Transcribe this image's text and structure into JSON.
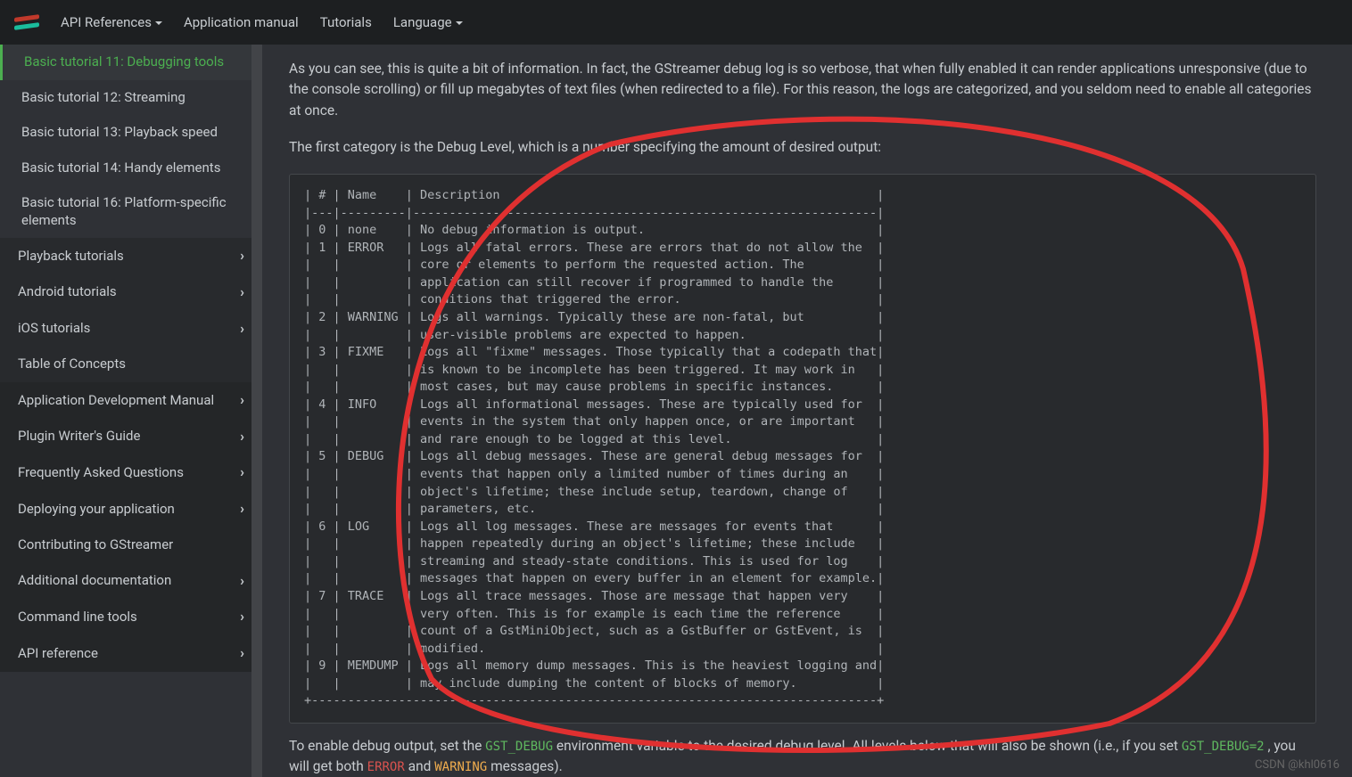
{
  "nav": {
    "api": "API References",
    "manual": "Application manual",
    "tutorials": "Tutorials",
    "language": "Language"
  },
  "sidebar": {
    "items": [
      {
        "label": "Basic tutorial 11: Debugging tools",
        "cls": "sb-item sub active"
      },
      {
        "label": "Basic tutorial 12: Streaming",
        "cls": "sb-item sub"
      },
      {
        "label": "Basic tutorial 13: Playback speed",
        "cls": "sb-item sub"
      },
      {
        "label": "Basic tutorial 14: Handy elements",
        "cls": "sb-item sub"
      },
      {
        "label": "Basic tutorial 16: Platform-specific elements",
        "cls": "sb-item sub"
      },
      {
        "label": "Playback tutorials",
        "cls": "sb-item dark",
        "chev": true
      },
      {
        "label": "Android tutorials",
        "cls": "sb-item dark",
        "chev": true
      },
      {
        "label": "iOS tutorials",
        "cls": "sb-item dark",
        "chev": true
      },
      {
        "label": "Table of Concepts",
        "cls": "sb-item dark"
      },
      {
        "label": "Application Development Manual",
        "cls": "sb-item dark2",
        "chev": true
      },
      {
        "label": "Plugin Writer's Guide",
        "cls": "sb-item dark2",
        "chev": true
      },
      {
        "label": "Frequently Asked Questions",
        "cls": "sb-item dark2",
        "chev": true
      },
      {
        "label": "Deploying your application",
        "cls": "sb-item dark2",
        "chev": true
      },
      {
        "label": "Contributing to GStreamer",
        "cls": "sb-item dark2"
      },
      {
        "label": "Additional documentation",
        "cls": "sb-item dark2",
        "chev": true
      },
      {
        "label": "Command line tools",
        "cls": "sb-item dark2",
        "chev": true
      },
      {
        "label": "API reference",
        "cls": "sb-item dark2",
        "chev": true
      }
    ]
  },
  "content": {
    "p1": "As you can see, this is quite a bit of information. In fact, the GStreamer debug log is so verbose, that when fully enabled it can render applications unresponsive (due to the console scrolling) or fill up megabytes of text files (when redirected to a file). For this reason, the logs are categorized, and you seldom need to enable all categories at once.",
    "p2": "The first category is the Debug Level, which is a number specifying the amount of desired output:",
    "code": "| # | Name    | Description                                                    |\n|---|---------|----------------------------------------------------------------|\n| 0 | none    | No debug information is output.                                |\n| 1 | ERROR   | Logs all fatal errors. These are errors that do not allow the  |\n|   |         | core or elements to perform the requested action. The          |\n|   |         | application can still recover if programmed to handle the      |\n|   |         | conditions that triggered the error.                           |\n| 2 | WARNING | Logs all warnings. Typically these are non-fatal, but          |\n|   |         | user-visible problems are expected to happen.                  |\n| 3 | FIXME   | Logs all \"fixme\" messages. Those typically that a codepath that|\n|   |         | is known to be incomplete has been triggered. It may work in   |\n|   |         | most cases, but may cause problems in specific instances.      |\n| 4 | INFO    | Logs all informational messages. These are typically used for  |\n|   |         | events in the system that only happen once, or are important   |\n|   |         | and rare enough to be logged at this level.                    |\n| 5 | DEBUG   | Logs all debug messages. These are general debug messages for  |\n|   |         | events that happen only a limited number of times during an    |\n|   |         | object's lifetime; these include setup, teardown, change of    |\n|   |         | parameters, etc.                                               |\n| 6 | LOG     | Logs all log messages. These are messages for events that      |\n|   |         | happen repeatedly during an object's lifetime; these include   |\n|   |         | streaming and steady-state conditions. This is used for log    |\n|   |         | messages that happen on every buffer in an element for example.|\n| 7 | TRACE   | Logs all trace messages. Those are message that happen very    |\n|   |         | very often. This is for example is each time the reference     |\n|   |         | count of a GstMiniObject, such as a GstBuffer or GstEvent, is  |\n|   |         | modified.                                                      |\n| 9 | MEMDUMP | Logs all memory dump messages. This is the heaviest logging and|\n|   |         | may include dumping the content of blocks of memory.           |\n+------------------------------------------------------------------------------+",
    "p3a": "To enable debug output, set the ",
    "p3_gst": "GST_DEBUG",
    "p3b": " environment variable to the desired debug level. All levels below that will also be shown (i.e., if you set ",
    "p3_gst2": "GST_DEBUG=2",
    "p3c": " , you will get both ",
    "p3_err": "ERROR",
    "p3d": " and ",
    "p3_warn": "WARNING",
    "p3e": " messages)."
  },
  "watermark": "CSDN @khl0616"
}
